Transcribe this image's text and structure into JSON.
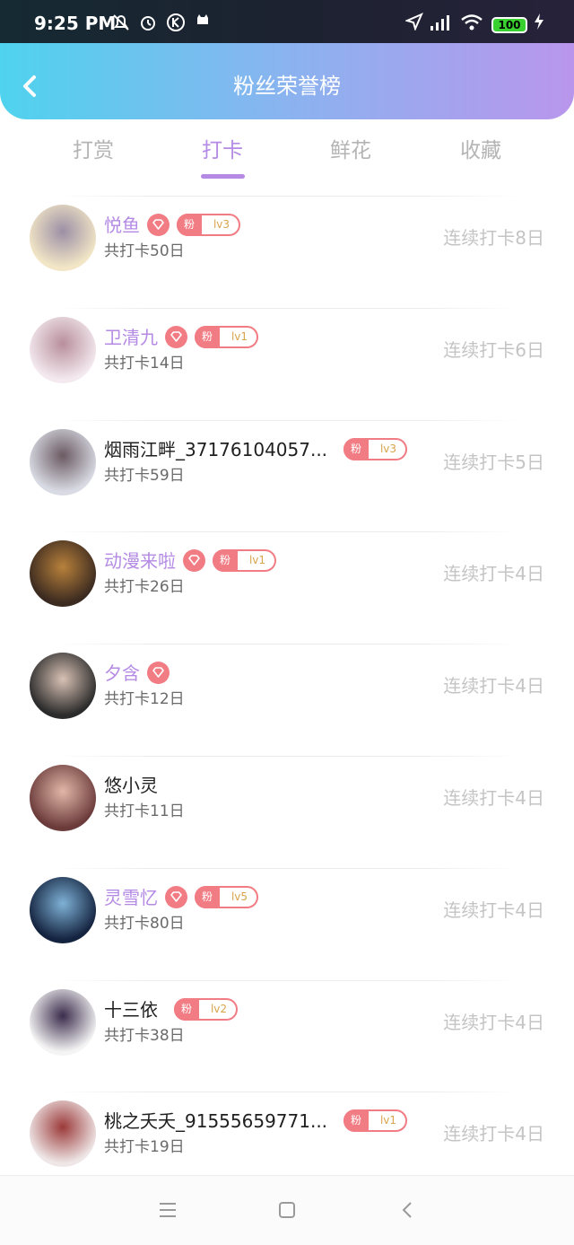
{
  "status_bar": {
    "time": "9:25 PM",
    "battery": "100"
  },
  "header": {
    "title": "粉丝荣誉榜"
  },
  "tabs": [
    {
      "label": "打赏"
    },
    {
      "label": "打卡"
    },
    {
      "label": "鲜花"
    },
    {
      "label": "收藏"
    }
  ],
  "active_tab": "打卡",
  "colors": {
    "accent": "#b48ae4",
    "badge": "#f27c84",
    "streak": "#c4c4c4"
  },
  "fan_badge_prefix": "粉",
  "rows": [
    {
      "name": "悦鱼",
      "total": "共打卡50日",
      "streak": "连续打卡8日",
      "vip": true,
      "level": "lv3"
    },
    {
      "name": "卫清九",
      "total": "共打卡14日",
      "streak": "连续打卡6日",
      "vip": true,
      "level": "lv1"
    },
    {
      "name": "烟雨江畔_37176104057...",
      "total": "共打卡59日",
      "streak": "连续打卡5日",
      "vip": false,
      "level": "lv3"
    },
    {
      "name": "动漫来啦",
      "total": "共打卡26日",
      "streak": "连续打卡4日",
      "vip": true,
      "level": "lv1"
    },
    {
      "name": "夕含",
      "total": "共打卡12日",
      "streak": "连续打卡4日",
      "vip": true,
      "level": ""
    },
    {
      "name": "悠小灵",
      "total": "共打卡11日",
      "streak": "连续打卡4日",
      "vip": false,
      "level": ""
    },
    {
      "name": "灵雪忆",
      "total": "共打卡80日",
      "streak": "连续打卡4日",
      "vip": true,
      "level": "lv5"
    },
    {
      "name": "十三依",
      "total": "共打卡38日",
      "streak": "连续打卡4日",
      "vip": false,
      "level": "lv2"
    },
    {
      "name": "桃之夭夭_91555659771...",
      "total": "共打卡19日",
      "streak": "连续打卡4日",
      "vip": false,
      "level": "lv1"
    }
  ]
}
